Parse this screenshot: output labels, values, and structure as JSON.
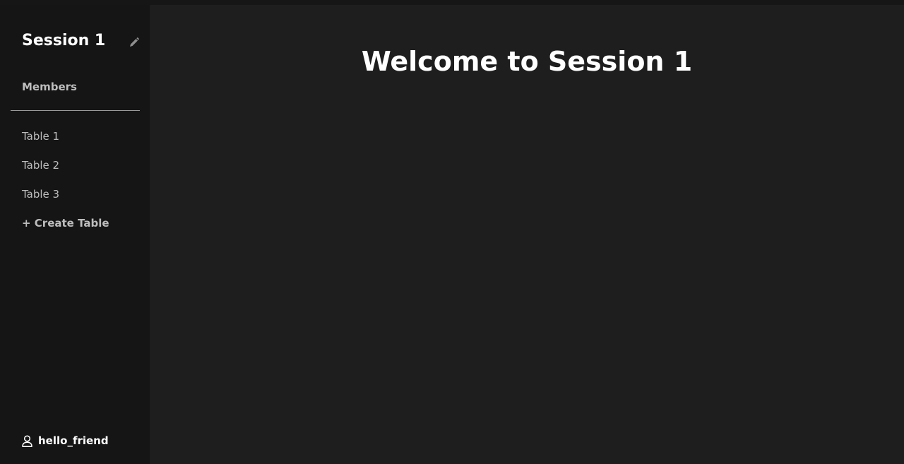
{
  "sidebar": {
    "session_title": "Session 1",
    "edit_icon": "pencil-icon",
    "members_label": "Members",
    "tables": [
      {
        "label": "Table 1"
      },
      {
        "label": "Table 2"
      },
      {
        "label": "Table 3"
      }
    ],
    "create_table_label": "+ Create Table",
    "user": {
      "icon": "user-icon",
      "name": "hello_friend"
    }
  },
  "main": {
    "heading": "Welcome to Session 1"
  },
  "colors": {
    "sidebar_bg": "#151515",
    "main_bg": "#1e1e1e",
    "text_primary": "#ffffff",
    "text_muted": "#bdbdbd"
  }
}
